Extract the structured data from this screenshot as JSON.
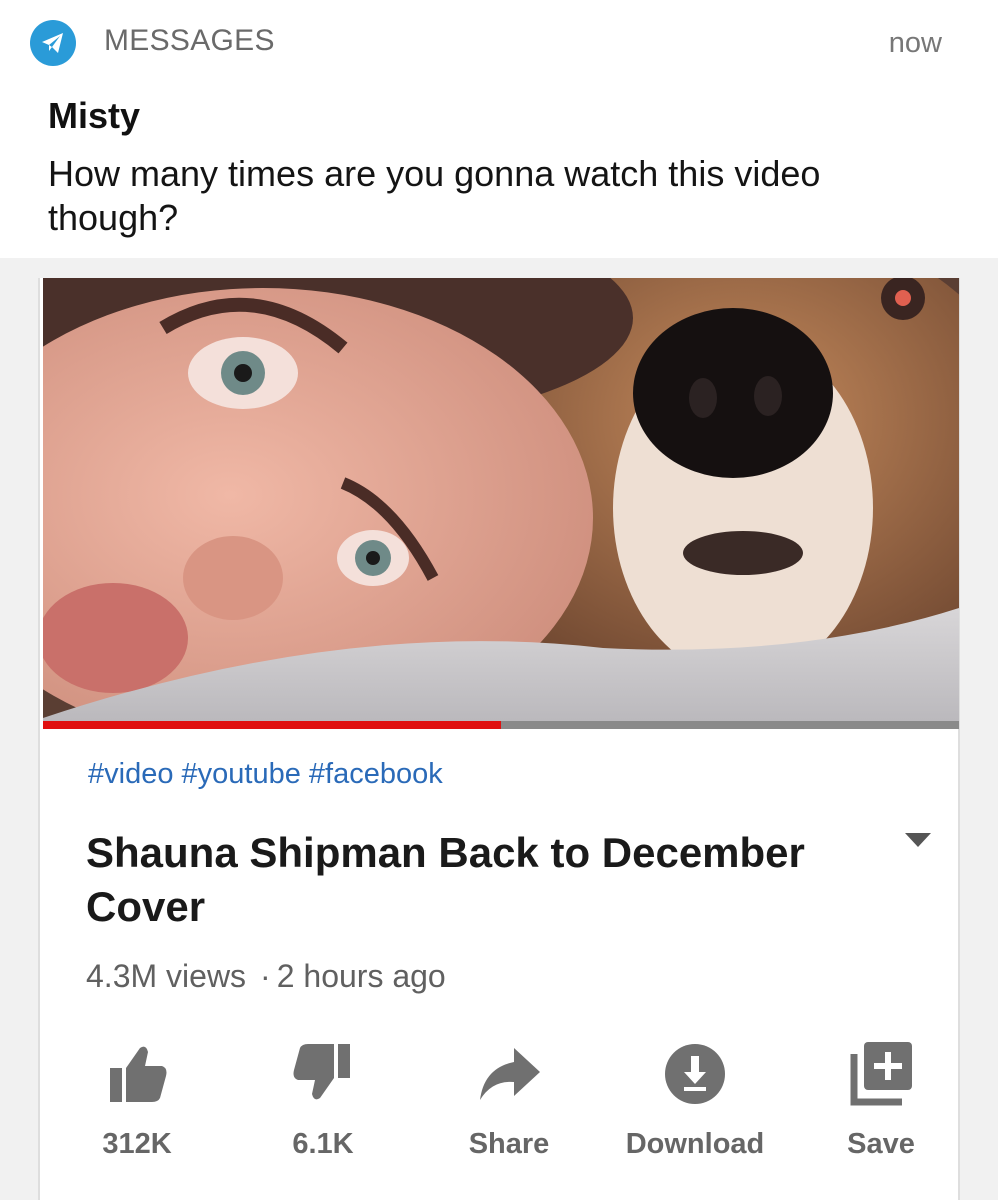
{
  "notification": {
    "app_name": "MESSAGES",
    "time": "now",
    "sender": "Misty",
    "message": "How many times are you gonna watch this video though?"
  },
  "video": {
    "progress_fraction": 0.5,
    "hashtags": "#video #youtube #facebook",
    "title": "Shauna Shipman Back to December Cover",
    "views": "4.3M views",
    "separator": "·",
    "age": "2 hours ago"
  },
  "actions": [
    {
      "icon": "thumbs-up-icon",
      "label": "312K"
    },
    {
      "icon": "thumbs-down-icon",
      "label": "6.1K"
    },
    {
      "icon": "share-icon",
      "label": "Share"
    },
    {
      "icon": "download-icon",
      "label": "Download"
    },
    {
      "icon": "save-icon",
      "label": "Save"
    }
  ],
  "colors": {
    "app_icon": "#2a9bd8",
    "hashtag": "#2a6ab8",
    "progress": "#e01010",
    "icon_gray": "#707070"
  }
}
